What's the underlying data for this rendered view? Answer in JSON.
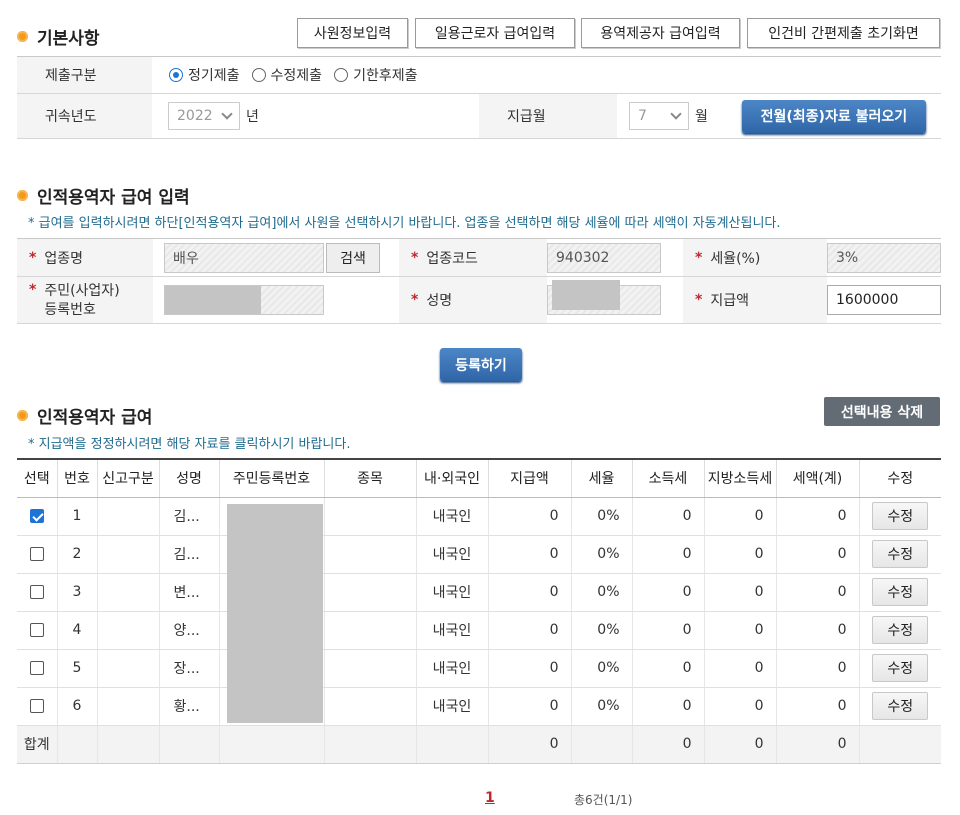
{
  "basic": {
    "title": "기본사항",
    "top_buttons": [
      "사원정보입력",
      "일용근로자 급여입력",
      "용역제공자 급여입력",
      "인건비 간편제출 초기화면"
    ],
    "submit_type_label": "제출구분",
    "submit_options": [
      "정기제출",
      "수정제출",
      "기한후제출"
    ],
    "submit_selected": "정기제출",
    "year_label": "귀속년도",
    "year_value": "2022",
    "year_unit": "년",
    "month_label": "지급월",
    "month_value": "7",
    "month_unit": "월",
    "load_button": "전월(최종)자료 불러오기"
  },
  "input": {
    "title": "인적용역자 급여 입력",
    "note": "* 급여를 입력하시려면 하단[인적용역자 급여]에서 사원을 선택하시기 바랍니다. 업종을 선택하면 해당 세율에 따라 세액이 자동계산됩니다.",
    "req_mark": "*",
    "industry_label": "업종명",
    "industry_value": "배우",
    "search_button": "검색",
    "code_label": "업종코드",
    "code_value": "940302",
    "rate_label": "세율(%)",
    "rate_value": "3%",
    "regno_label_1": "주민(사업자)",
    "regno_label_2": "등록번호",
    "name_label": "성명",
    "amount_label": "지급액",
    "amount_value": "1600000",
    "register_button": "등록하기"
  },
  "list": {
    "title": "인적용역자 급여",
    "delete_button": "선택내용 삭제",
    "note": "* 지급액을 정정하시려면 해당 자료를 클릭하시기 바랍니다.",
    "headers": [
      "선택",
      "번호",
      "신고구분",
      "성명",
      "주민등록번호",
      "종목",
      "내·외국인",
      "지급액",
      "세율",
      "소득세",
      "지방소득세",
      "세액(계)",
      "수정"
    ],
    "rows": [
      {
        "checked": true,
        "no": "1",
        "type": "",
        "name": "김...",
        "kind": "",
        "nation": "내국인",
        "amount": "0",
        "rate": "0%",
        "income_tax": "0",
        "local_tax": "0",
        "total_tax": "0",
        "edit": "수정"
      },
      {
        "checked": false,
        "no": "2",
        "type": "",
        "name": "김...",
        "kind": "",
        "nation": "내국인",
        "amount": "0",
        "rate": "0%",
        "income_tax": "0",
        "local_tax": "0",
        "total_tax": "0",
        "edit": "수정"
      },
      {
        "checked": false,
        "no": "3",
        "type": "",
        "name": "변...",
        "kind": "",
        "nation": "내국인",
        "amount": "0",
        "rate": "0%",
        "income_tax": "0",
        "local_tax": "0",
        "total_tax": "0",
        "edit": "수정"
      },
      {
        "checked": false,
        "no": "4",
        "type": "",
        "name": "양...",
        "kind": "",
        "nation": "내국인",
        "amount": "0",
        "rate": "0%",
        "income_tax": "0",
        "local_tax": "0",
        "total_tax": "0",
        "edit": "수정"
      },
      {
        "checked": false,
        "no": "5",
        "type": "",
        "name": "장...",
        "kind": "",
        "nation": "내국인",
        "amount": "0",
        "rate": "0%",
        "income_tax": "0",
        "local_tax": "0",
        "total_tax": "0",
        "edit": "수정"
      },
      {
        "checked": false,
        "no": "6",
        "type": "",
        "name": "황...",
        "kind": "",
        "nation": "내국인",
        "amount": "0",
        "rate": "0%",
        "income_tax": "0",
        "local_tax": "0",
        "total_tax": "0",
        "edit": "수정"
      }
    ],
    "total": {
      "label": "합계",
      "amount": "0",
      "income_tax": "0",
      "local_tax": "0",
      "total_tax": "0"
    }
  },
  "pagination": {
    "current": "1",
    "summary": "총6건(1/1)"
  }
}
